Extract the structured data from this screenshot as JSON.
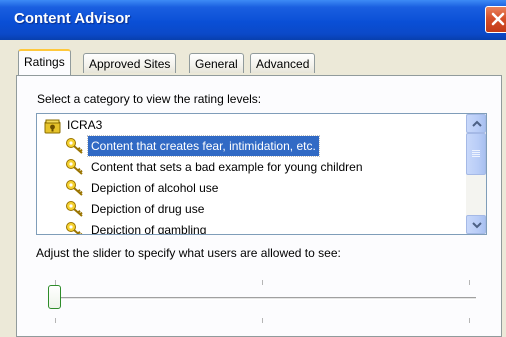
{
  "window": {
    "title": "Content Advisor"
  },
  "tabs": [
    {
      "label": "Ratings"
    },
    {
      "label": "Approved Sites"
    },
    {
      "label": "General"
    },
    {
      "label": "Advanced"
    }
  ],
  "ratings": {
    "category_instruction": "Select a category to view the rating levels:",
    "categories": [
      {
        "label": "ICRA3",
        "icon": "rating-system-icon"
      },
      {
        "label": "Content that creates fear, intimidation, etc.",
        "icon": "key-icon",
        "selected": true
      },
      {
        "label": "Content that sets a bad example for young children",
        "icon": "key-icon"
      },
      {
        "label": "Depiction of alcohol use",
        "icon": "key-icon"
      },
      {
        "label": "Depiction of drug use",
        "icon": "key-icon"
      },
      {
        "label": "Depiction of gambling",
        "icon": "key-icon"
      }
    ],
    "slider_instruction": "Adjust the slider to specify what users are allowed to see:",
    "slider_level": 0
  },
  "colors": {
    "titlebar": "#0a4fd6",
    "selection": "#316ac5",
    "close_button": "#d6502a",
    "slider_knob_border": "#2e8c2a"
  }
}
